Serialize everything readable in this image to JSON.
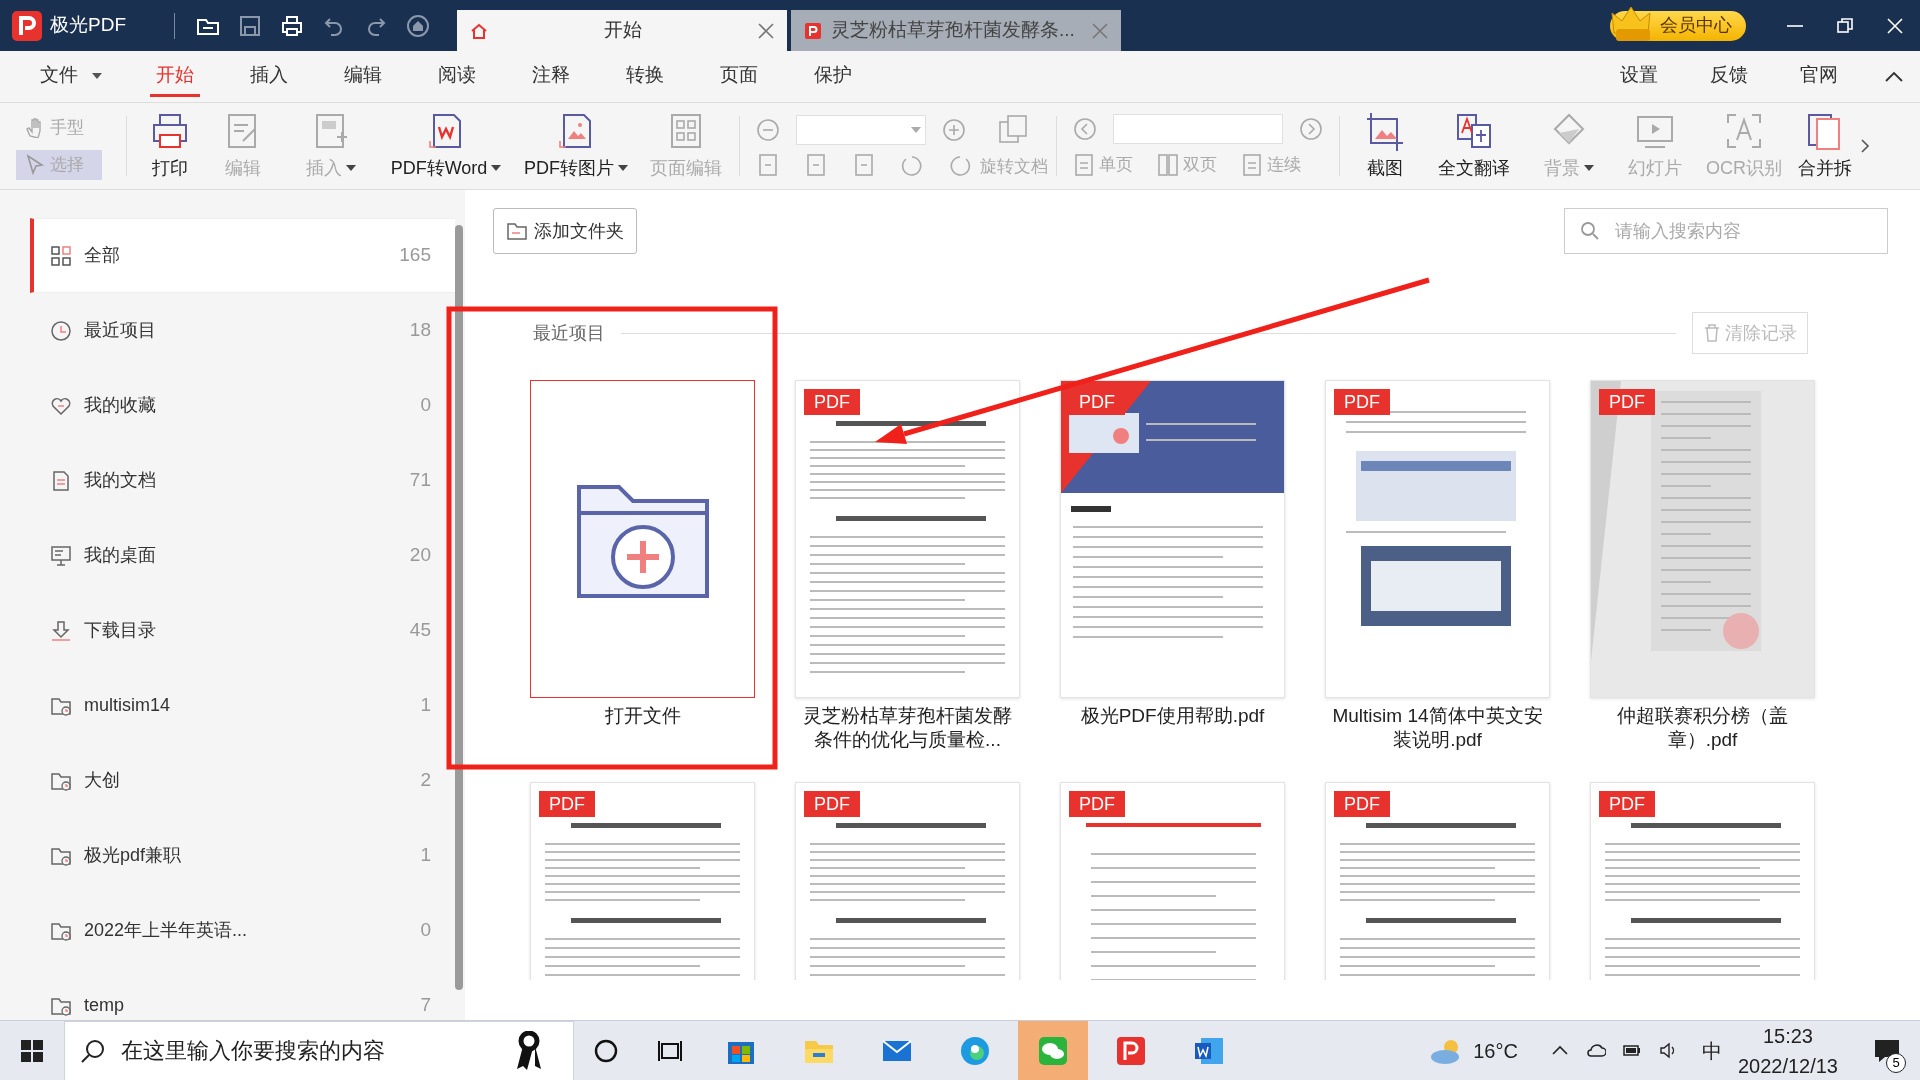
{
  "app": {
    "name": "极光PDF"
  },
  "tabs": [
    {
      "label": "开始",
      "selected": true,
      "kind": "home"
    },
    {
      "label": "灵芝粉枯草芽孢杆菌发酵条...",
      "selected": false,
      "kind": "pdf"
    }
  ],
  "vip": {
    "label": "会员中心"
  },
  "menu": [
    {
      "label": "文件",
      "selected": false,
      "kind": "dropdown"
    },
    {
      "label": "开始",
      "selected": true,
      "kind": "tab"
    },
    {
      "label": "插入",
      "selected": false,
      "kind": "tab"
    },
    {
      "label": "编辑",
      "selected": false,
      "kind": "tab"
    },
    {
      "label": "阅读",
      "selected": false,
      "kind": "tab"
    },
    {
      "label": "注释",
      "selected": false,
      "kind": "tab"
    },
    {
      "label": "转换",
      "selected": false,
      "kind": "tab"
    },
    {
      "label": "页面",
      "selected": false,
      "kind": "tab"
    },
    {
      "label": "保护",
      "selected": false,
      "kind": "tab"
    }
  ],
  "menu_links": [
    "设置",
    "反馈",
    "官网"
  ],
  "modes": [
    {
      "label": "手型",
      "selected": false
    },
    {
      "label": "选择",
      "selected": true
    }
  ],
  "tools_a": [
    {
      "label": "打印",
      "disabled": false,
      "dropdown": false
    },
    {
      "label": "编辑",
      "disabled": true,
      "dropdown": false
    },
    {
      "label": "插入",
      "disabled": true,
      "dropdown": true
    },
    {
      "label": "PDF转Word",
      "disabled": false,
      "dropdown": true
    },
    {
      "label": "PDF转图片",
      "disabled": false,
      "dropdown": true
    },
    {
      "label": "页面编辑",
      "disabled": true,
      "dropdown": false
    }
  ],
  "rotate": {
    "label": "旋转文档",
    "disabled": true
  },
  "views": [
    {
      "label": "单页",
      "disabled": true
    },
    {
      "label": "双页",
      "disabled": true
    },
    {
      "label": "连续",
      "disabled": true
    }
  ],
  "tools_b": [
    {
      "label": "截图",
      "disabled": false,
      "dropdown": false
    },
    {
      "label": "全文翻译",
      "disabled": false,
      "dropdown": false
    },
    {
      "label": "背景",
      "disabled": true,
      "dropdown": true
    },
    {
      "label": "幻灯片",
      "disabled": true,
      "dropdown": false
    },
    {
      "label": "OCR识别",
      "disabled": true,
      "dropdown": false
    },
    {
      "label": "合并拆",
      "disabled": false,
      "dropdown": false
    }
  ],
  "sidebar": {
    "items": [
      {
        "label": "全部",
        "count": "165",
        "selected": true,
        "kind": "all"
      },
      {
        "label": "最近项目",
        "count": "18",
        "selected": false,
        "kind": "recent"
      },
      {
        "label": "我的收藏",
        "count": "0",
        "selected": false,
        "kind": "favorite"
      },
      {
        "label": "我的文档",
        "count": "71",
        "selected": false,
        "kind": "docs"
      },
      {
        "label": "我的桌面",
        "count": "20",
        "selected": false,
        "kind": "desktop"
      },
      {
        "label": "下载目录",
        "count": "45",
        "selected": false,
        "kind": "download"
      },
      {
        "label": "multisim14",
        "count": "1",
        "selected": false,
        "kind": "folder"
      },
      {
        "label": "大创",
        "count": "2",
        "selected": false,
        "kind": "folder"
      },
      {
        "label": "极光pdf兼职",
        "count": "1",
        "selected": false,
        "kind": "folder"
      },
      {
        "label": "2022年上半年英语...",
        "count": "0",
        "selected": false,
        "kind": "folder"
      },
      {
        "label": "temp",
        "count": "7",
        "selected": false,
        "kind": "folder"
      }
    ]
  },
  "add_folder": {
    "label": "添加文件夹"
  },
  "search": {
    "placeholder": "请输入搜索内容"
  },
  "recent": {
    "title": "最近项目",
    "clear": {
      "label": "清除记录",
      "disabled": true
    },
    "files": [
      {
        "kind": "open",
        "title": "打开文件"
      },
      {
        "kind": "paper",
        "badge": "PDF",
        "title": "灵芝粉枯草芽孢杆菌发酵条件的优化与质量检..."
      },
      {
        "kind": "guide",
        "badge": "PDF",
        "title": "极光PDF使用帮助.pdf"
      },
      {
        "kind": "manual",
        "badge": "PDF",
        "title": "Multisim 14简体中英文安装说明.pdf"
      },
      {
        "kind": "scan",
        "badge": "PDF",
        "title": "仲超联赛积分榜（盖章）.pdf"
      },
      {
        "kind": "paper",
        "badge": "PDF"
      },
      {
        "kind": "paper",
        "badge": "PDF"
      },
      {
        "kind": "notice",
        "badge": "PDF"
      },
      {
        "kind": "paper",
        "badge": "PDF"
      },
      {
        "kind": "paper",
        "badge": "PDF"
      }
    ]
  },
  "taskbar": {
    "search": {
      "placeholder": "在这里输入你要搜索的内容"
    },
    "apps": [
      {
        "kind": "store",
        "active": false
      },
      {
        "kind": "explorer",
        "active": false
      },
      {
        "kind": "mail",
        "active": false
      },
      {
        "kind": "edge",
        "active": false
      },
      {
        "kind": "wechat",
        "active": true
      },
      {
        "kind": "pdf",
        "active": false
      },
      {
        "kind": "word",
        "active": false
      }
    ],
    "temperature": "16°C",
    "ime": "中",
    "time": "15:23",
    "date": "2022/12/13",
    "notifications": "5"
  }
}
